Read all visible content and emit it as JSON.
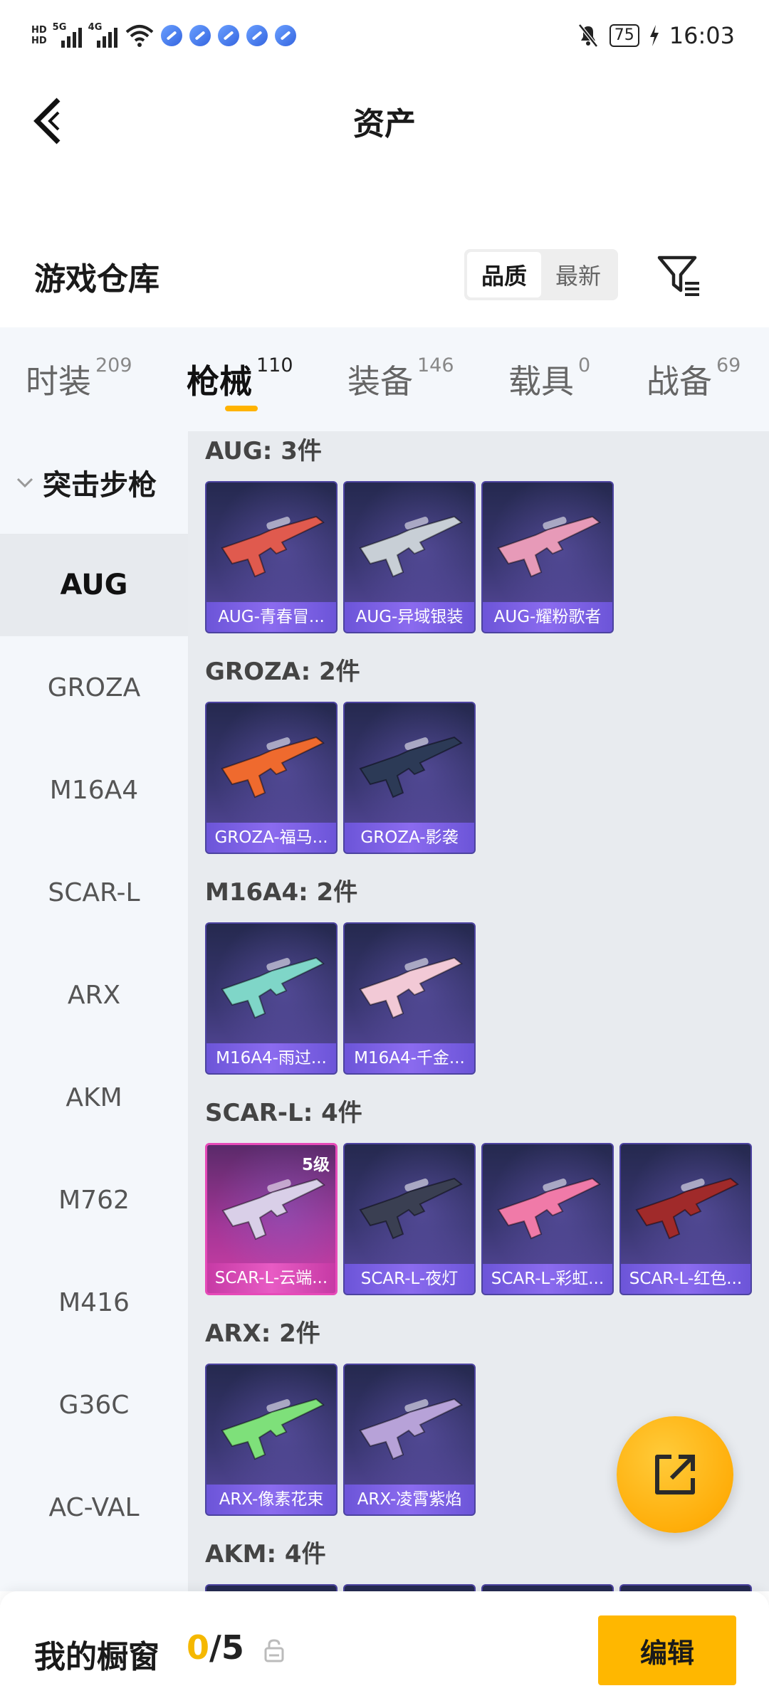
{
  "status_bar": {
    "hd_top": "HD",
    "hd_bottom": "HD",
    "net1": "5G",
    "net2": "4G",
    "battery": "75",
    "time": "16:03"
  },
  "header": {
    "title": "资产"
  },
  "warehouse": {
    "title": "游戏仓库",
    "sort_options": [
      "品质",
      "最新"
    ],
    "active_sort": "品质"
  },
  "tabs": [
    {
      "label": "时装",
      "count": "209"
    },
    {
      "label": "枪械",
      "count": "110"
    },
    {
      "label": "装备",
      "count": "146"
    },
    {
      "label": "载具",
      "count": "0"
    },
    {
      "label": "战备",
      "count": "69"
    }
  ],
  "active_tab": "枪械",
  "sidebar": {
    "group": "突击步枪",
    "items": [
      "AUG",
      "GROZA",
      "M16A4",
      "SCAR-L",
      "ARX",
      "AKM",
      "M762",
      "M416",
      "G36C",
      "AC-VAL"
    ],
    "active": "AUG"
  },
  "sections": [
    {
      "title": "AUG: 3件",
      "items": [
        {
          "name": "AUG-青春冒...",
          "color": "#e05a4e"
        },
        {
          "name": "AUG-异域银装",
          "color": "#c8cfd6"
        },
        {
          "name": "AUG-耀粉歌者",
          "color": "#e79ab8"
        }
      ]
    },
    {
      "title": "GROZA: 2件",
      "items": [
        {
          "name": "GROZA-福马...",
          "color": "#ef6a2e"
        },
        {
          "name": "GROZA-影袭",
          "color": "#2c3a56"
        }
      ]
    },
    {
      "title": "M16A4: 2件",
      "items": [
        {
          "name": "M16A4-雨过...",
          "color": "#7fd6c8"
        },
        {
          "name": "M16A4-千金...",
          "color": "#f2c9d6"
        }
      ]
    },
    {
      "title": "SCAR-L: 4件",
      "items": [
        {
          "name": "SCAR-L-云端...",
          "color": "#d9cfe8",
          "level": "5级",
          "highlight": true
        },
        {
          "name": "SCAR-L-夜灯",
          "color": "#3a3f52"
        },
        {
          "name": "SCAR-L-彩虹...",
          "color": "#f07aa8"
        },
        {
          "name": "SCAR-L-红色...",
          "color": "#a02a2a"
        }
      ]
    },
    {
      "title": "ARX: 2件",
      "items": [
        {
          "name": "ARX-像素花束",
          "color": "#7ee07a"
        },
        {
          "name": "ARX-凌霄紫焰",
          "color": "#b7a2d8"
        }
      ]
    },
    {
      "title": "AKM: 4件",
      "items": []
    }
  ],
  "bottom_bar": {
    "label": "我的橱窗",
    "current": "0",
    "separator": "/",
    "total": "5",
    "edit_label": "编辑"
  }
}
